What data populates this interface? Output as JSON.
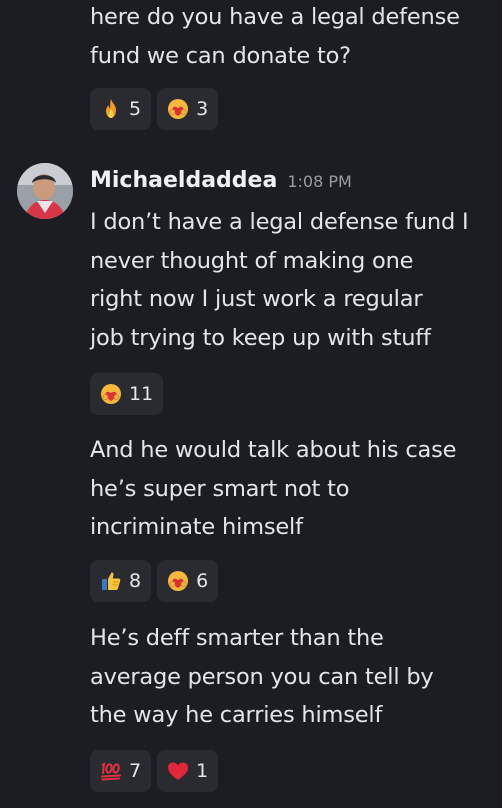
{
  "messages": {
    "prev": {
      "lines": [
        "here do you have a legal defense",
        "fund we can donate to?"
      ],
      "reactions": [
        {
          "emoji": "fire-emoji",
          "count": "5"
        },
        {
          "emoji": "heart-hug-emoji",
          "count": "3"
        }
      ]
    },
    "author": {
      "name": "Michaeldaddea",
      "time": "1:08 PM"
    },
    "m1": {
      "lines": [
        "I don’t have a legal defense fund I",
        "never thought of making one",
        "right now I just work a regular",
        "job trying to keep up with stuff"
      ],
      "reactions": [
        {
          "emoji": "heart-hug-emoji",
          "count": "11"
        }
      ]
    },
    "m2": {
      "lines": [
        "And he would talk about his case",
        "he’s super smart not to",
        "incriminate himself"
      ],
      "reactions": [
        {
          "emoji": "thumbs-up-emoji",
          "count": "8"
        },
        {
          "emoji": "heart-hug-emoji",
          "count": "6"
        }
      ]
    },
    "m3": {
      "lines": [
        "He’s deff smarter than the",
        "average person you can tell by",
        "the way he carries himself"
      ],
      "reactions": [
        {
          "emoji": "hundred-points-emoji",
          "count": "7"
        },
        {
          "emoji": "red-heart-emoji",
          "count": "1"
        }
      ]
    }
  }
}
